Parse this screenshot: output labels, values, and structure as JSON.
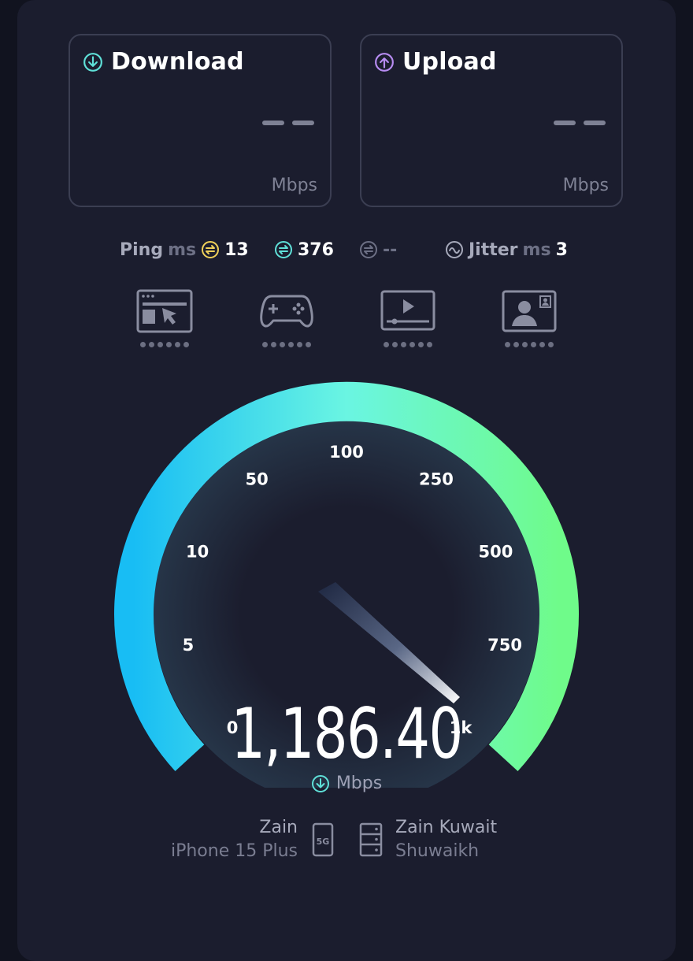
{
  "download": {
    "title": "Download",
    "unit": "Mbps",
    "icon": "download-arrow-icon",
    "color": "#5fe0d8"
  },
  "upload": {
    "title": "Upload",
    "unit": "Mbps",
    "icon": "upload-arrow-icon",
    "color": "#b78cf2"
  },
  "stats": {
    "ping_label": "Ping",
    "ping_unit": "ms",
    "idle_ping": "13",
    "download_ping": "376",
    "upload_ping": "--",
    "jitter_label": "Jitter",
    "jitter_unit": "ms",
    "jitter": "3"
  },
  "activities": [
    {
      "name": "web-browsing-icon",
      "rating": 0
    },
    {
      "name": "gaming-icon",
      "rating": 0
    },
    {
      "name": "video-streaming-icon",
      "rating": 0
    },
    {
      "name": "video-call-icon",
      "rating": 0
    }
  ],
  "gauge": {
    "ticks": [
      "0",
      "5",
      "10",
      "50",
      "100",
      "250",
      "500",
      "750",
      "1k"
    ],
    "reading": "1,186.40",
    "unit": "Mbps",
    "colors": {
      "start": "#18bdf4",
      "middle": "#6af5e2",
      "end": "#6ffb8a"
    }
  },
  "device": {
    "carrier": "Zain",
    "model": "iPhone 15 Plus",
    "network": "5G"
  },
  "server": {
    "name": "Zain Kuwait",
    "location": "Shuwaikh"
  }
}
